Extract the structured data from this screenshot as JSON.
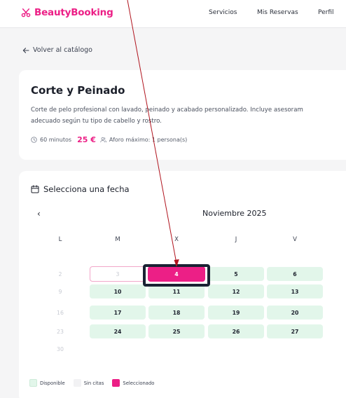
{
  "header": {
    "brand": "BeautyBooking",
    "nav": [
      "Servicios",
      "Mis Reservas",
      "Perfil"
    ]
  },
  "back_link": "Volver al catálogo",
  "service": {
    "title": "Corte y Peinado",
    "description_line1": "Corte de pelo profesional con lavado, peinado y acabado personalizado. Incluye asesoram",
    "description_line2": "adecuado según tu tipo de cabello y rostro.",
    "duration": "60 minutos",
    "price": "25 €",
    "capacity": "Aforo máximo: 1 persona(s)"
  },
  "calendar": {
    "heading": "Selecciona una fecha",
    "prev_label": "‹",
    "month": "Noviembre 2025",
    "weekdays": [
      "L",
      "M",
      "X",
      "J",
      "V"
    ],
    "weeks": [
      [
        {
          "d": "2",
          "s": "empty"
        },
        {
          "d": "3",
          "s": "border"
        },
        {
          "d": "4",
          "s": "sel"
        },
        {
          "d": "5",
          "s": "avail"
        },
        {
          "d": "6",
          "s": "avail"
        }
      ],
      [
        {
          "d": "9",
          "s": "empty"
        },
        {
          "d": "10",
          "s": "avail"
        },
        {
          "d": "11",
          "s": "avail"
        },
        {
          "d": "12",
          "s": "avail"
        },
        {
          "d": "13",
          "s": "avail"
        }
      ],
      [
        {
          "d": "16",
          "s": "empty"
        },
        {
          "d": "17",
          "s": "avail"
        },
        {
          "d": "18",
          "s": "avail"
        },
        {
          "d": "19",
          "s": "avail"
        },
        {
          "d": "20",
          "s": "avail"
        }
      ],
      [
        {
          "d": "23",
          "s": "empty"
        },
        {
          "d": "24",
          "s": "avail"
        },
        {
          "d": "25",
          "s": "avail"
        },
        {
          "d": "26",
          "s": "avail"
        },
        {
          "d": "27",
          "s": "avail"
        }
      ],
      [
        {
          "d": "30",
          "s": "empty"
        }
      ]
    ],
    "legend": [
      "Disponible",
      "Sin citas",
      "Seleccionado"
    ]
  },
  "colors": {
    "accent": "#ec1f86",
    "available": "#e2f6ea",
    "highlight_box": "#1a2233",
    "arrow": "#b0141e"
  }
}
